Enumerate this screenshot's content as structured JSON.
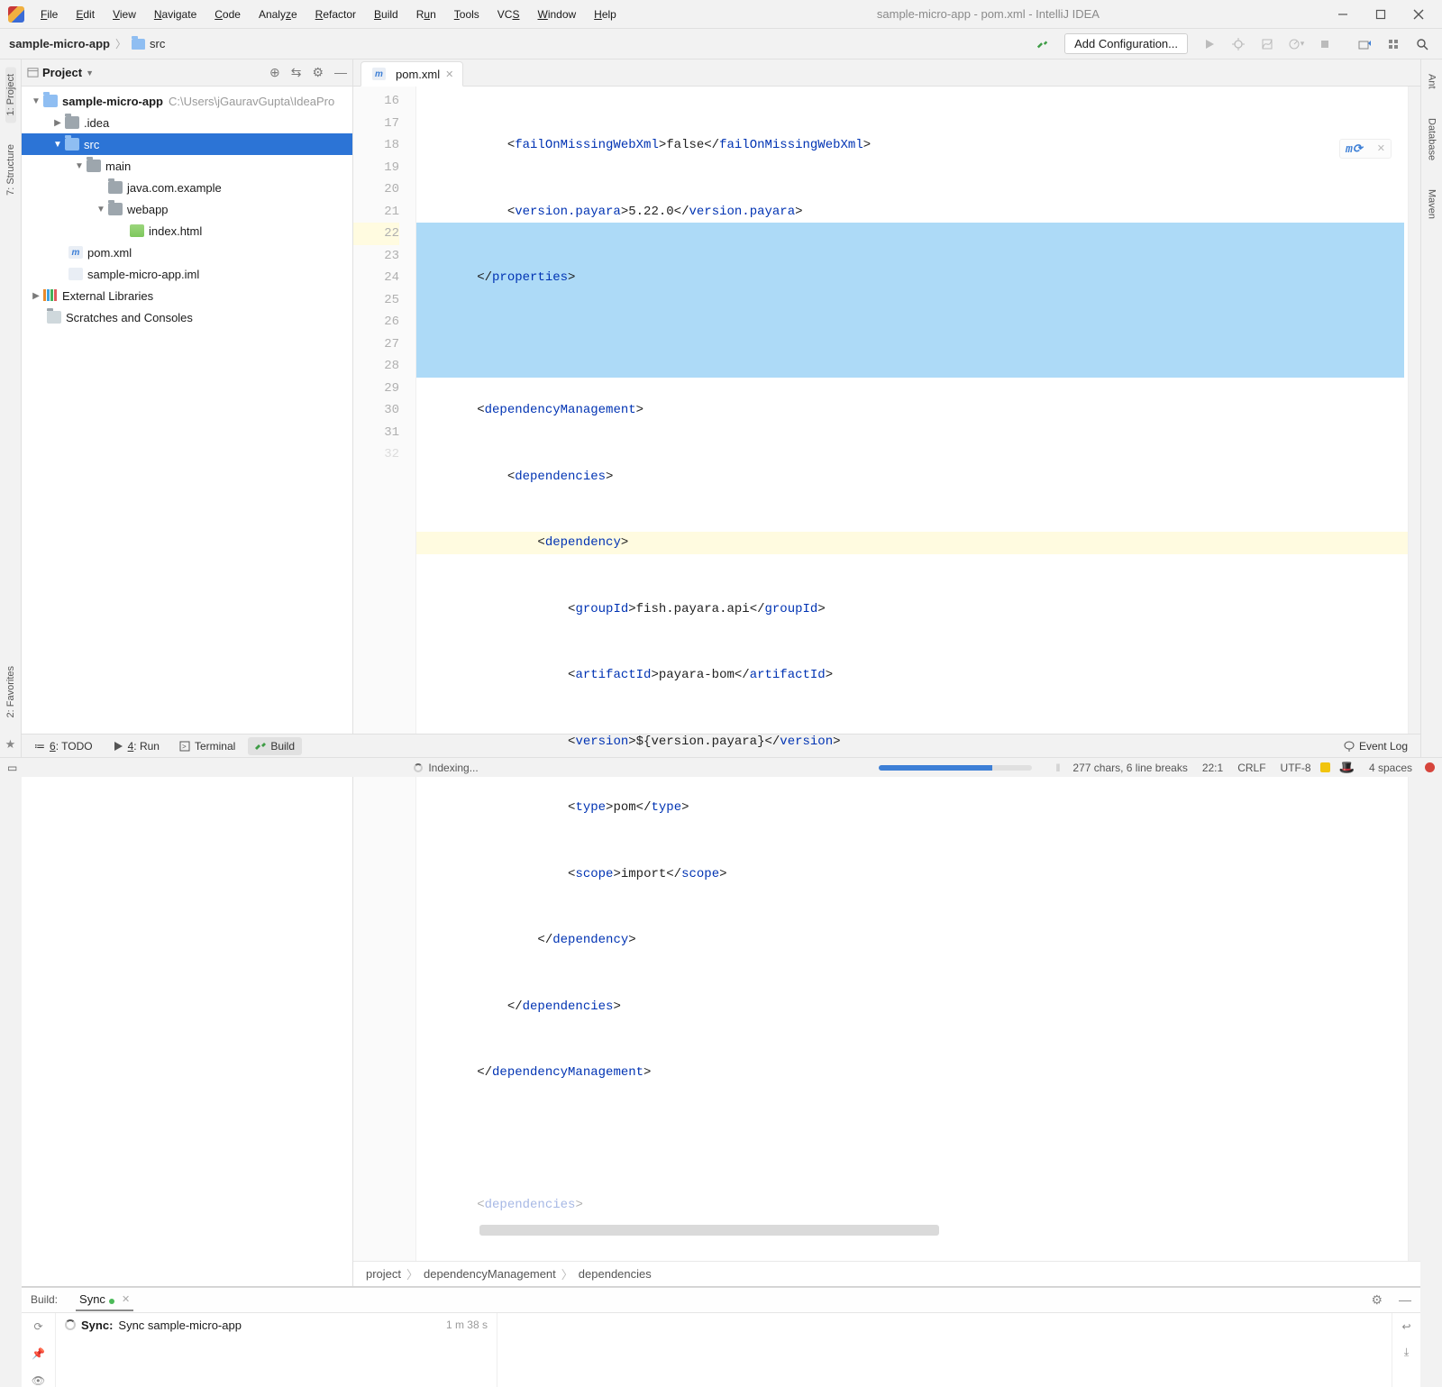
{
  "window_title": "sample-micro-app - pom.xml - IntelliJ IDEA",
  "menus": [
    "File",
    "Edit",
    "View",
    "Navigate",
    "Code",
    "Analyze",
    "Refactor",
    "Build",
    "Run",
    "Tools",
    "VCS",
    "Window",
    "Help"
  ],
  "breadcrumb": {
    "root": "sample-micro-app",
    "child": "src"
  },
  "toolbar": {
    "add_configuration": "Add Configuration..."
  },
  "left_rail": {
    "project": "1: Project",
    "structure": "7: Structure",
    "favorites": "2: Favorites"
  },
  "right_rail": {
    "ant": "Ant",
    "database": "Database",
    "maven": "Maven"
  },
  "project_tool": {
    "title": "Project",
    "tree": {
      "root": {
        "name": "sample-micro-app",
        "path": "C:\\Users\\jGauravGupta\\IdeaProjects\\sample-micro-app"
      },
      "idea": ".idea",
      "src": "src",
      "main": "main",
      "java_pkg": "java.com.example",
      "webapp": "webapp",
      "index_html": "index.html",
      "pom": "pom.xml",
      "iml": "sample-micro-app.iml",
      "ext_lib": "External Libraries",
      "scratches": "Scratches and Consoles"
    }
  },
  "editor": {
    "tab": "pom.xml",
    "line_start": 16,
    "line_end": 32,
    "chart_data": null,
    "code": {
      "l16": {
        "indent": 16,
        "open": "failOnMissingWebXml",
        "text": "false",
        "close": "failOnMissingWebXml"
      },
      "l17": {
        "indent": 16,
        "open": "version.payara",
        "text": "5.22.0",
        "close": "version.payara"
      },
      "l18": {
        "indent": 12,
        "close": "properties"
      },
      "l20": {
        "indent": 12,
        "open_only": "dependencyManagement"
      },
      "l21": {
        "indent": 16,
        "open_only": "dependencies"
      },
      "l22": {
        "indent": 20,
        "open_only": "dependency"
      },
      "l23": {
        "indent": 24,
        "open": "groupId",
        "text": "fish.payara.api",
        "close": "groupId"
      },
      "l24": {
        "indent": 24,
        "open": "artifactId",
        "text": "payara-bom",
        "close": "artifactId"
      },
      "l25": {
        "indent": 24,
        "open": "version",
        "text": "${version.payara}",
        "close": "version"
      },
      "l26": {
        "indent": 24,
        "open": "type",
        "text": "pom",
        "close": "type"
      },
      "l27": {
        "indent": 24,
        "open": "scope",
        "text": "import",
        "close": "scope"
      },
      "l28": {
        "indent": 20,
        "close": "dependency"
      },
      "l29": {
        "indent": 16,
        "close": "dependencies"
      },
      "l30": {
        "indent": 12,
        "close": "dependencyManagement"
      }
    },
    "crumbs": [
      "project",
      "dependencyManagement",
      "dependencies"
    ]
  },
  "build": {
    "label": "Build:",
    "tab": "Sync",
    "entry_title": "Sync:",
    "entry_text": "Sync sample-micro-app",
    "entry_time": "1 m 38 s"
  },
  "bottom_tools": {
    "todo": "6: TODO",
    "run": "4: Run",
    "terminal": "Terminal",
    "build": "Build",
    "event_log": "Event Log"
  },
  "status": {
    "indexing": "Indexing...",
    "sel_info": "277 chars, 6 line breaks",
    "pos": "22:1",
    "linesep": "CRLF",
    "encoding": "UTF-8",
    "indent": "4 spaces"
  }
}
